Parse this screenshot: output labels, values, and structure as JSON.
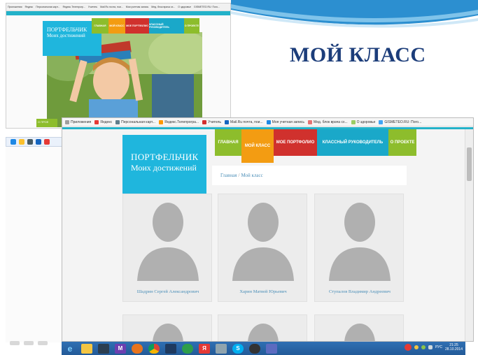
{
  "slide": {
    "title": "МОЙ КЛАСС"
  },
  "small_window": {
    "bookmarks": [
      "Приложения",
      "Яндекс",
      "Персональная карт...",
      "Яндекс.Телепрогр...",
      "Учитель",
      "Mail.Ru почта, пои...",
      "Моя учетная запись",
      "Мед. блок врача сх...",
      "О здоровье",
      "GISMETEO.RU: Пого..."
    ],
    "logo_line1": "ПОРТФЕЛЬЧИК",
    "logo_line2": "Моих достижений",
    "nav": [
      "ГЛАВНАЯ",
      "МОЙ КЛАСС",
      "МОЕ ПОРТФОЛИО",
      "КЛАССНЫЙ РУКОВОДИТЕЛЬ",
      "О ПРОЕКТЕ"
    ],
    "about_label": "О ПРОЕ"
  },
  "browser": {
    "bookmarks": [
      {
        "label": "Приложения",
        "color": "#9e9e9e"
      },
      {
        "label": "Яндекс",
        "color": "#e53935"
      },
      {
        "label": "Персональная карт...",
        "color": "#607d8b"
      },
      {
        "label": "Яндекс.Телепрогра...",
        "color": "#ff9800"
      },
      {
        "label": "Учитель",
        "color": "#d32f2f"
      },
      {
        "label": "Mail.Ru почта, пои...",
        "color": "#1565c0"
      },
      {
        "label": "Моя учетная запись",
        "color": "#1e88e5"
      },
      {
        "label": "Мед. блок врача сх...",
        "color": "#e57373"
      },
      {
        "label": "О здоровье",
        "color": "#9ccc65"
      },
      {
        "label": "GISMETEO.RU: Пого...",
        "color": "#42a5f5"
      }
    ]
  },
  "site": {
    "logo_line1": "ПОРТФЕЛЬЧИК",
    "logo_line2": "Моих достижений",
    "nav": [
      {
        "label": "ГЛАВНАЯ",
        "color": "#8dbd2c"
      },
      {
        "label": "МОЙ КЛАСС",
        "color": "#f39c12"
      },
      {
        "label": "МОЕ ПОРТФОЛИО",
        "color": "#d0312d"
      },
      {
        "label": "КЛАССНЫЙ РУКОВОДИТЕЛЬ",
        "color": "#1aa8c9"
      },
      {
        "label": "О ПРОЕКТЕ",
        "color": "#8dbd2c"
      }
    ],
    "breadcrumb": {
      "home": "Главная",
      "separator": "/",
      "current": "Мой класс"
    },
    "students": [
      {
        "name": "Шадрин Сергей Александрович"
      },
      {
        "name": "Харин Матвей Юрьевич"
      },
      {
        "name": "Ступалов Владимир Андреевич"
      }
    ]
  },
  "taskbar": {
    "icons": [
      "ie-icon",
      "explorer-icon",
      "computer-icon",
      "mail-icon",
      "firefox-icon",
      "chrome-icon",
      "app-icon",
      "media-icon",
      "yandex-icon",
      "sound-icon",
      "skype-icon",
      "player-icon",
      "document-icon"
    ],
    "language": "РУС",
    "time": "21:25",
    "date": "28.10.2014"
  },
  "colors": {
    "teal": "#1fb6dd",
    "title_blue": "#1c3d7a",
    "link_blue": "#4c8fb8"
  }
}
